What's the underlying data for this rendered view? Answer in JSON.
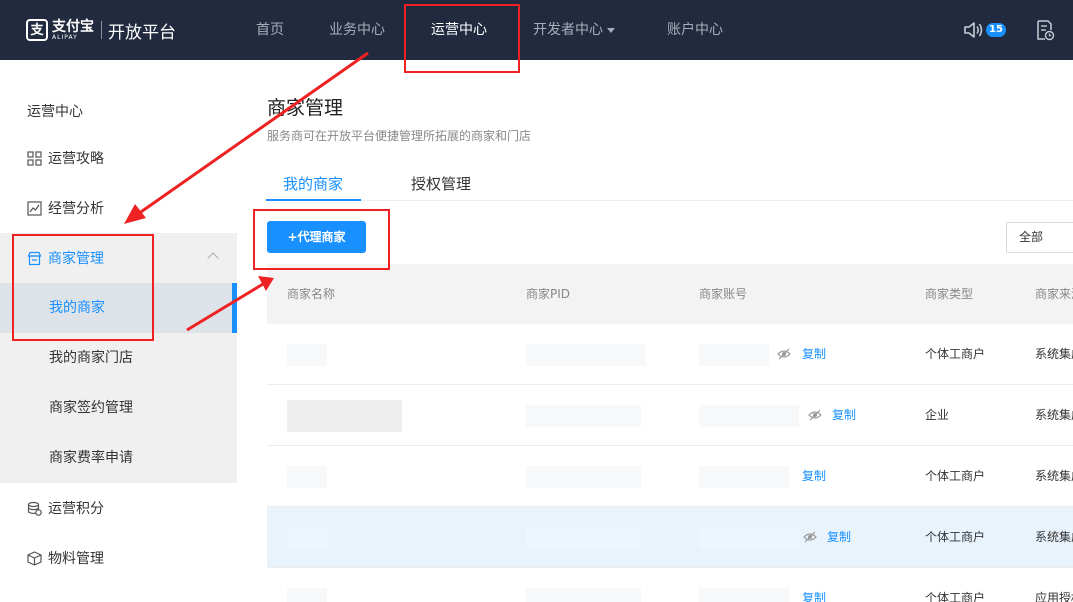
{
  "brand": {
    "alipay_cn": "支付宝",
    "alipay_en": "ALIPAY",
    "platform": "开放平台"
  },
  "topnav": {
    "items": [
      {
        "label": "首页"
      },
      {
        "label": "业务中心"
      },
      {
        "label": "运营中心",
        "active": true
      },
      {
        "label": "开发者中心",
        "has_dropdown": true
      },
      {
        "label": "账户中心"
      }
    ],
    "notification_count": "15"
  },
  "sidebar": {
    "heading": "运营中心",
    "items": [
      {
        "label": "运营攻略",
        "icon": "grid-icon"
      },
      {
        "label": "经营分析",
        "icon": "chart-icon"
      },
      {
        "label": "商家管理",
        "icon": "store-icon",
        "expanded": true
      },
      {
        "label": "运营积分",
        "icon": "coins-icon"
      },
      {
        "label": "物料管理",
        "icon": "box-icon"
      }
    ],
    "sub_items": [
      {
        "label": "我的商家",
        "selected": true
      },
      {
        "label": "我的商家门店"
      },
      {
        "label": "商家签约管理"
      },
      {
        "label": "商家费率申请"
      }
    ]
  },
  "main": {
    "title": "商家管理",
    "subtitle": "服务商可在开放平台便捷管理所拓展的商家和门店",
    "tabs": [
      {
        "label": "我的商家",
        "active": true
      },
      {
        "label": "授权管理"
      }
    ],
    "add_button": "+代理商家",
    "filter_value": "全部",
    "table": {
      "columns": [
        "商家名称",
        "商家PID",
        "商家账号",
        "商家类型",
        "商家来源"
      ],
      "rows": [
        {
          "name": "",
          "pid": "",
          "account": "",
          "type": "个体工商户",
          "source": "系统集成",
          "action": "复制"
        },
        {
          "name": "",
          "pid": "",
          "account": "",
          "type": "企业",
          "source": "系统集成",
          "action": "复制"
        },
        {
          "name": "",
          "pid": "",
          "account": "",
          "type": "个体工商户",
          "source": "系统集成",
          "action": "复制"
        },
        {
          "name": "",
          "pid": "",
          "account": "",
          "type": "个体工商户",
          "source": "系统集成",
          "action": "复制",
          "highlighted": true
        },
        {
          "name": "",
          "pid": "",
          "account": "",
          "type": "个体工商户",
          "source": "应用授权",
          "action": "复制"
        }
      ]
    }
  },
  "colors": {
    "topbar": "#212a3e",
    "accent": "#1890ff",
    "annotation": "#ee2222"
  }
}
